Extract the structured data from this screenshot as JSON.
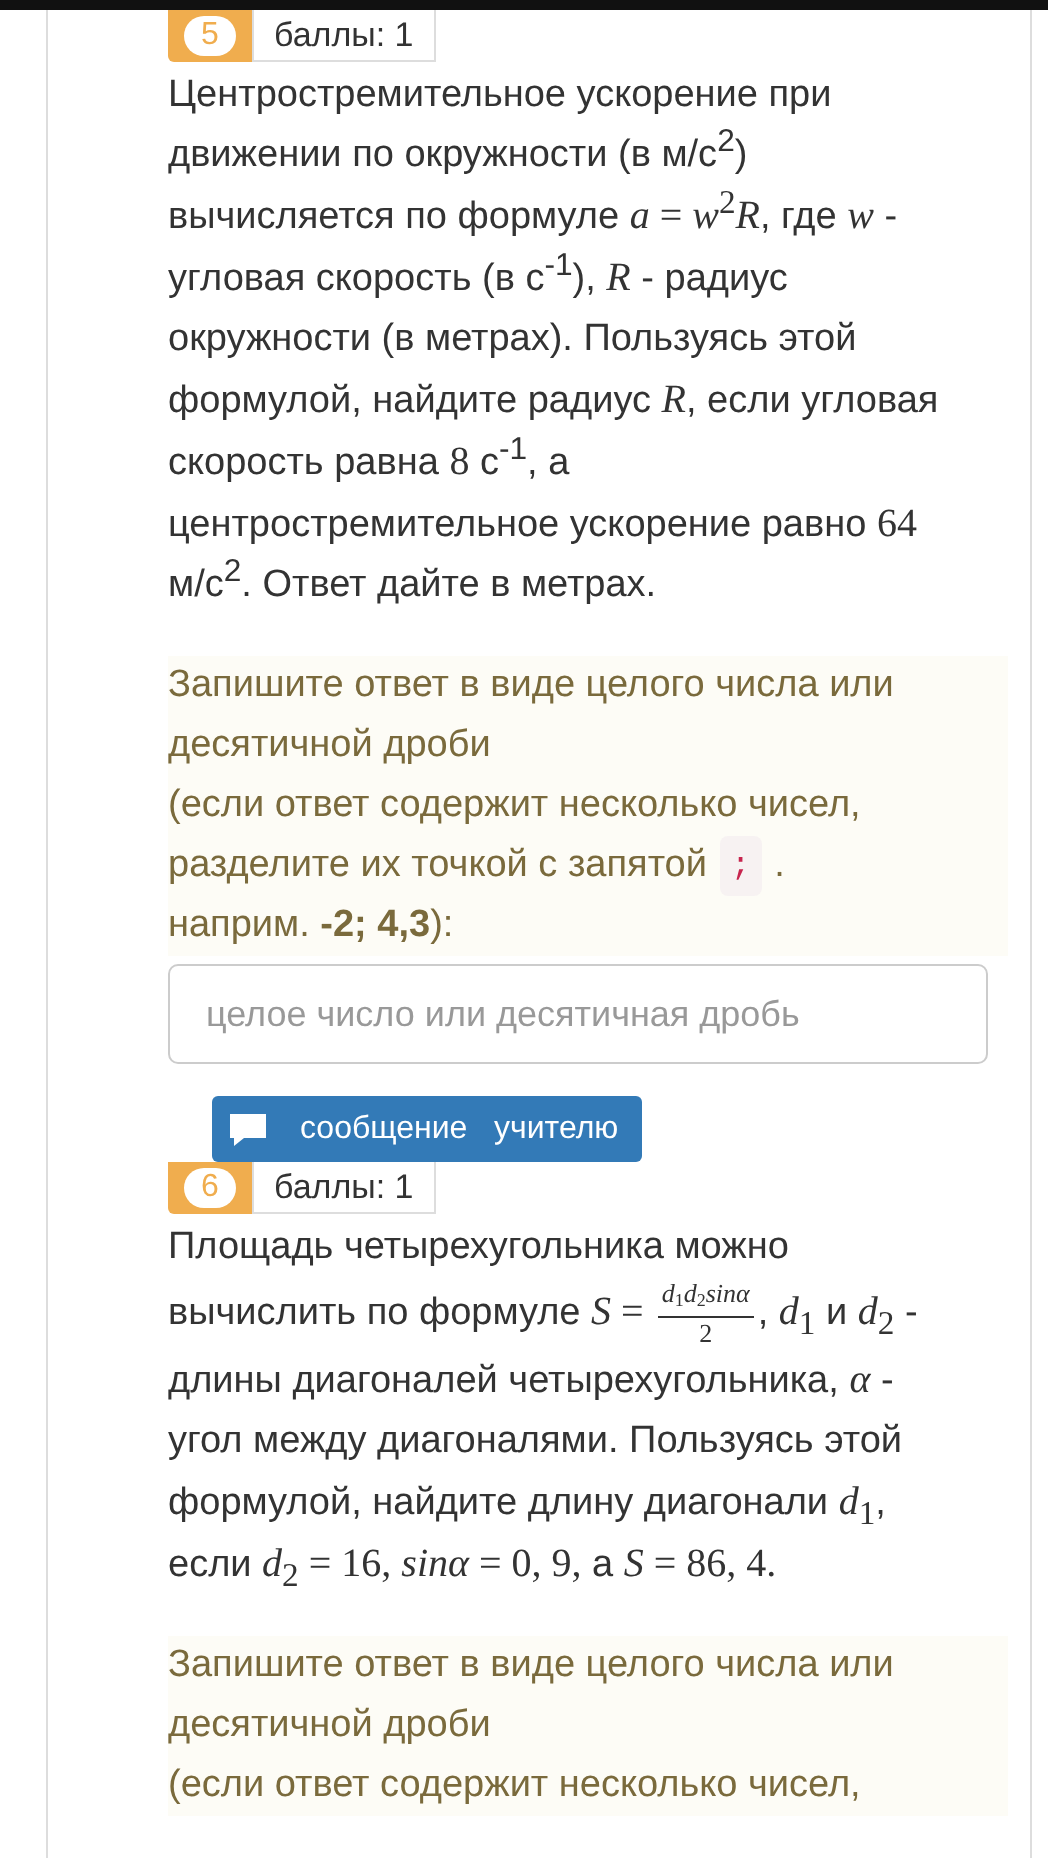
{
  "questions": [
    {
      "number": "5",
      "points": "баллы: 1",
      "text": [
        {
          "kind": "text",
          "text": "Центростремительное ускорение при движении по окружности (в м/с$^{2}$) вычисляется по формуле "
        },
        {
          "kind": "math",
          "text": "*a* = *w*$^{2}$*R*"
        },
        {
          "kind": "text",
          "text": ", где "
        },
        {
          "kind": "math",
          "text": "*w*"
        },
        {
          "kind": "text",
          "text": " - угловая скорость (в с$^{-1}$), "
        },
        {
          "kind": "math",
          "text": "*R*"
        },
        {
          "kind": "text",
          "text": " - радиус окружности (в метрах). Пользуясь этой формулой, найдите радиус "
        },
        {
          "kind": "math",
          "text": "*R*"
        },
        {
          "kind": "text",
          "text": ", если угловая скорость равна "
        },
        {
          "kind": "math",
          "text": "8"
        },
        {
          "kind": "text",
          "text": " с$^{-1}$, а центростремительное ускорение равно "
        },
        {
          "kind": "math",
          "text": "64"
        },
        {
          "kind": "text",
          "text": " м/с$^{2}$. Ответ дайте в метрах."
        }
      ],
      "hint": {
        "line": "Запишите ответ в виде целого числа или десятичной дроби",
        "note_before": "(если ответ содержит несколько чисел,",
        "separator_text": "разделите их точкой с запятой",
        "code": ";",
        "after_code": ".",
        "example": "наприм. **-2; 4,3**):"
      },
      "answer": {
        "placeholder": "целое число или десятичная дробь"
      },
      "message_button": "сообщение   учителю"
    },
    {
      "number": "6",
      "points": "баллы: 1",
      "text": [
        {
          "kind": "text",
          "text": "Площадь четырехугольника можно вычислить по формуле "
        },
        {
          "kind": "math",
          "text": "*S* = "
        },
        {
          "kind": "fraction",
          "numerator": "*d*$_{1}$*d*$_{2}$*sinα*",
          "denominator": "2"
        },
        {
          "kind": "text",
          "text": ", "
        },
        {
          "kind": "math",
          "text": "*d*$_{1}$"
        },
        {
          "kind": "text",
          "text": " и "
        },
        {
          "kind": "math",
          "text": "*d*$_{2}$"
        },
        {
          "kind": "text",
          "text": " - длины диагоналей четырехугольника, "
        },
        {
          "kind": "math",
          "text": "*α*"
        },
        {
          "kind": "text",
          "text": " - угол между диагоналями. Пользуясь этой формулой, найдите длину диагонали "
        },
        {
          "kind": "math",
          "text": "*d*$_{1}$"
        },
        {
          "kind": "text",
          "text": ", если "
        },
        {
          "kind": "math",
          "text": "*d*$_{2}$ = 16, *sinα* = 0, 9,"
        },
        {
          "kind": "text",
          "text": " а "
        },
        {
          "kind": "math",
          "text": "*S* = 86, 4."
        }
      ],
      "hint": {
        "line": "Запишите ответ в виде целого числа или десятичной дроби",
        "note_before": "(если ответ содержит несколько чисел,"
      }
    }
  ]
}
